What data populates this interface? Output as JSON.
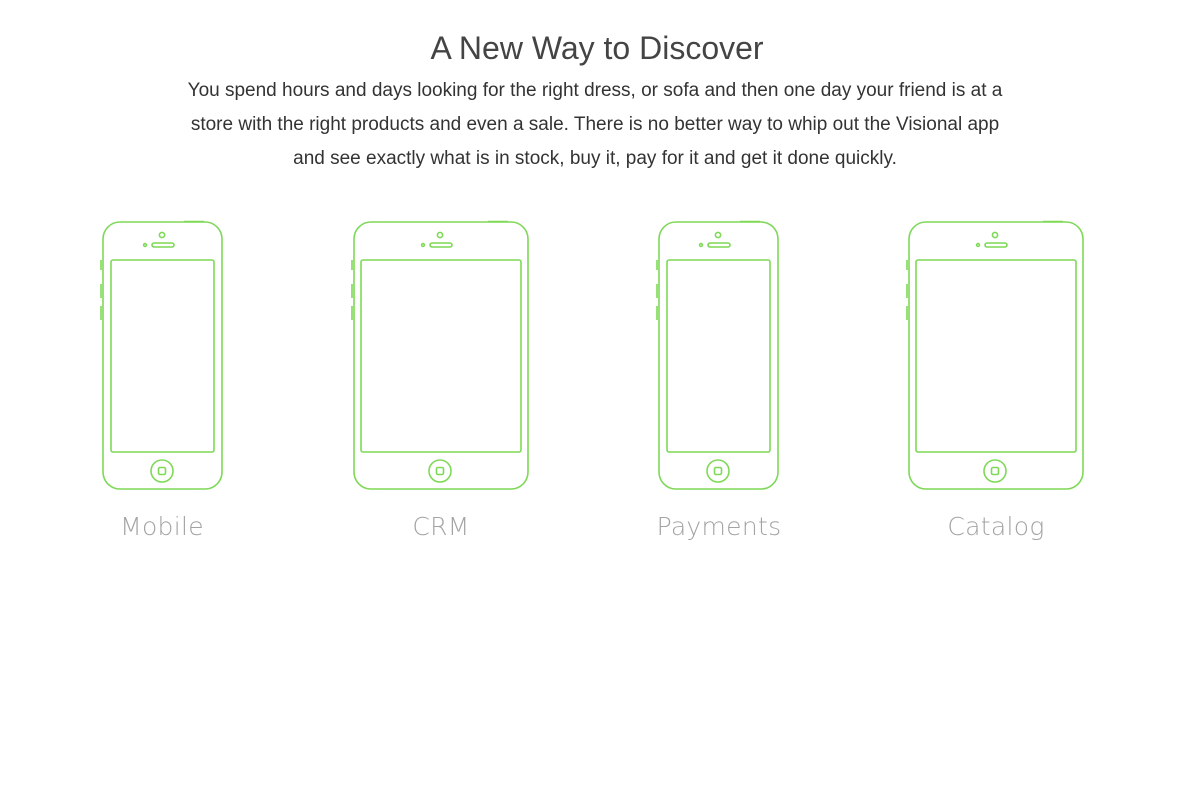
{
  "hero": {
    "title": "A New Way to Discover",
    "description": "You spend hours and days looking for the right dress, or sofa and then one day your friend is at a store with the right products and even a sale. There is no better way to whip out the Visional app and see exactly what is in stock, buy it, pay for it and get it done quickly."
  },
  "features": [
    {
      "label": "Mobile",
      "icon": "phone-outline-icon"
    },
    {
      "label": "CRM",
      "icon": "phone-outline-icon"
    },
    {
      "label": "Payments",
      "icon": "phone-outline-icon"
    },
    {
      "label": "Catalog",
      "icon": "phone-outline-icon"
    }
  ],
  "colors": {
    "icon_stroke": "#7ed957",
    "title": "#444444",
    "body": "#333333",
    "label": "#a3a3a3"
  }
}
